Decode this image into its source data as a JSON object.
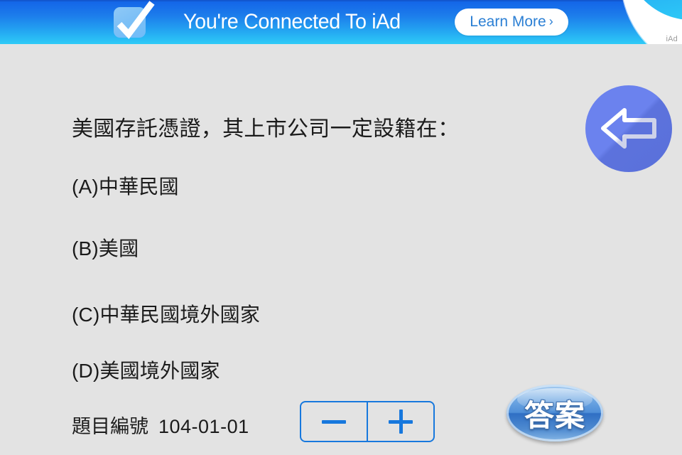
{
  "ad_banner": {
    "checkbox_icon": "checkmark-icon",
    "title": "You're Connected To iAd",
    "learn_more_label": "Learn More",
    "learn_more_chevron": "chevron-right-icon",
    "network_label": "iAd",
    "colors": {
      "gradient_top": "#1363e8",
      "gradient_bottom": "#2ecbf7",
      "button_text": "#2b7fd4",
      "title_text": "#ffffff"
    }
  },
  "back_button": {
    "icon": "back-arrow-icon",
    "color": "#6b82ee",
    "shadow_color": "#5569c4"
  },
  "quiz": {
    "question": "美國存託憑證，其上市公司一定設籍在：",
    "options": [
      {
        "label": "(A)中華民國"
      },
      {
        "label": "(B)美國"
      },
      {
        "label": "(C)中華民國境外國家"
      },
      {
        "label": "(D)美國境外國家"
      }
    ],
    "question_id_label": "題目編號",
    "question_id_value": "104-01-01",
    "stepper": {
      "decrement_label": "−",
      "increment_label": "+",
      "accent_color": "#1778dd"
    },
    "answer_button_label": "答案"
  },
  "page": {
    "background_color": "#e3e3e3",
    "text_color": "#1b1b1b"
  }
}
